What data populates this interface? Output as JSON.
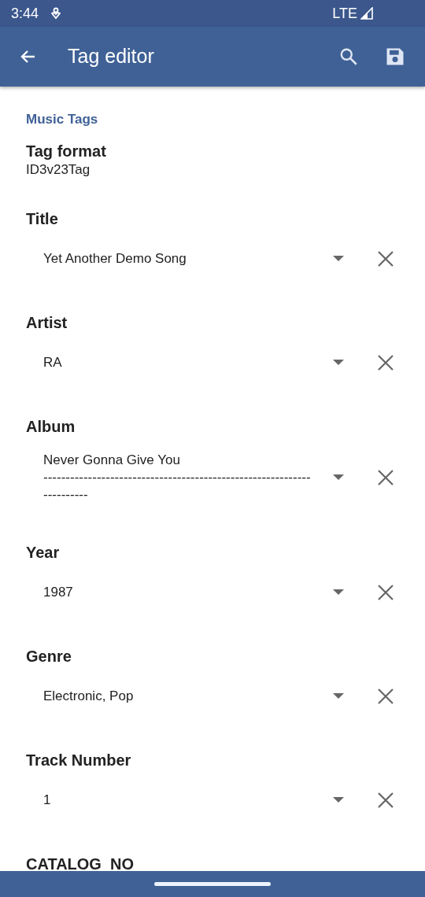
{
  "status_bar": {
    "time": "3:44",
    "network": "LTE"
  },
  "app_bar": {
    "title": "Tag editor"
  },
  "section": {
    "title": "Music Tags"
  },
  "tag_format": {
    "label": "Tag format",
    "value": "ID3v23Tag"
  },
  "fields": [
    {
      "label": "Title",
      "value": "Yet Another Demo Song"
    },
    {
      "label": "Artist",
      "value": "RA"
    },
    {
      "label": "Album",
      "value": "Never Gonna Give You\n----------------------------------------------------------------------"
    },
    {
      "label": "Year",
      "value": "1987"
    },
    {
      "label": "Genre",
      "value": "Electronic, Pop"
    },
    {
      "label": "Track Number",
      "value": "1"
    },
    {
      "label": "CATALOG_NO"
    }
  ]
}
